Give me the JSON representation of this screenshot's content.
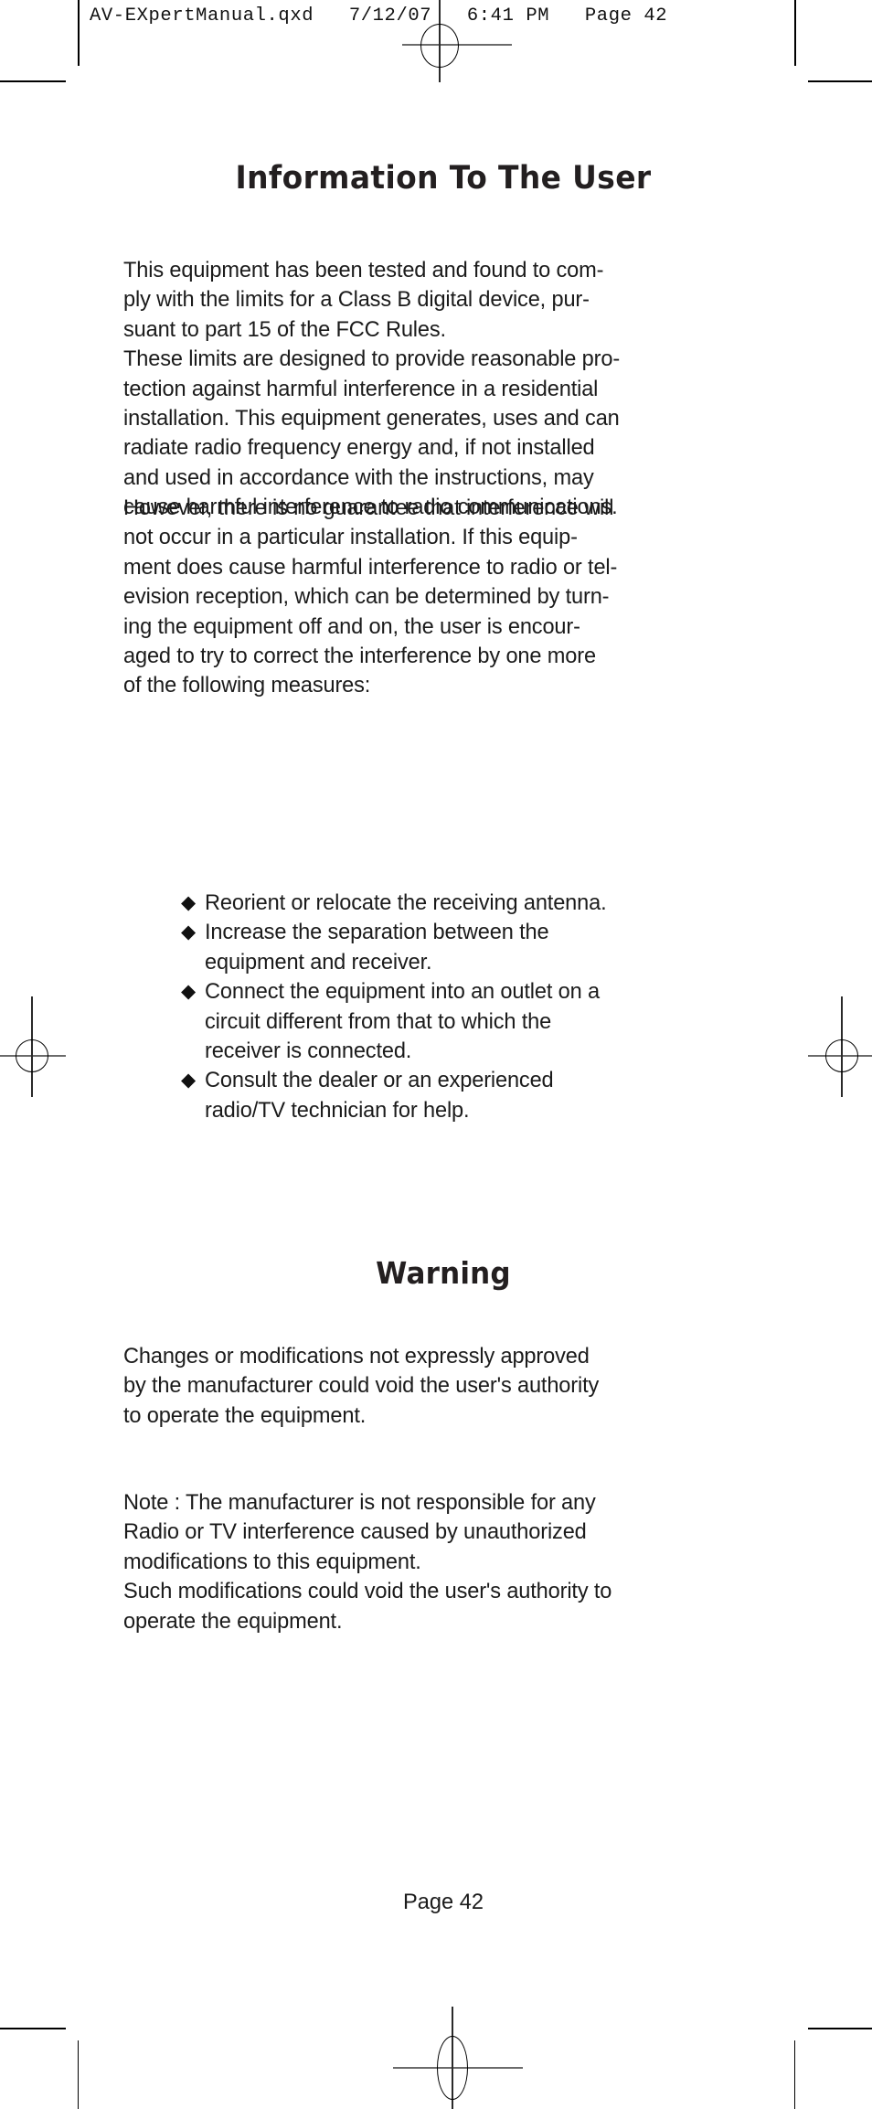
{
  "print_marks": {
    "header_slug": "AV-EXpertManual.qxd   7/12/07   6:41 PM   Page 42",
    "registration_top": "registration-mark-top",
    "registration_left": "registration-mark-left",
    "registration_right": "registration-mark-right",
    "registration_bottom": "registration-mark-bottom"
  },
  "document": {
    "title": "Information To The User",
    "paragraphs": {
      "intro": "This equipment has been tested and found to com-\nply with the limits for a Class B digital device, pur-\nsuant to part 15 of the FCC Rules.\nThese limits are designed to provide reasonable pro-\ntection against harmful interference in a residential\ninstallation. This equipment generates, uses and can\nradiate radio frequency energy and, if not installed\nand used in accordance with the instructions, may\ncause harmful interference to radio communications.",
      "however": "However, there is no guarantee that interference will\nnot occur in a particular installation. If this equip-\nment does cause harmful interference to radio or tel-\nevision reception, which can be determined by turn-\ning the equipment off and on, the user is encour-\naged to try to correct the interference by one more\nof the following measures:",
      "changes": "Changes or modifications not expressly approved\nby the manufacturer could void the user's authority\nto operate the equipment.",
      "note": "Note : The manufacturer is not responsible for any\nRadio or TV interference caused by unauthorized\nmodifications to this equipment.\nSuch modifications could void the user's authority to\noperate the equipment."
    },
    "bullet_marker": "◆",
    "measures": [
      "Reorient or relocate the receiving antenna.",
      "Increase the separation between the\nequipment and receiver.",
      "Connect the equipment into an outlet on a\ncircuit different from that to which the\nreceiver is connected.",
      "Consult the dealer or an experienced\nradio/TV technician for help."
    ],
    "warning_title": "Warning",
    "footer": "Page 42"
  }
}
